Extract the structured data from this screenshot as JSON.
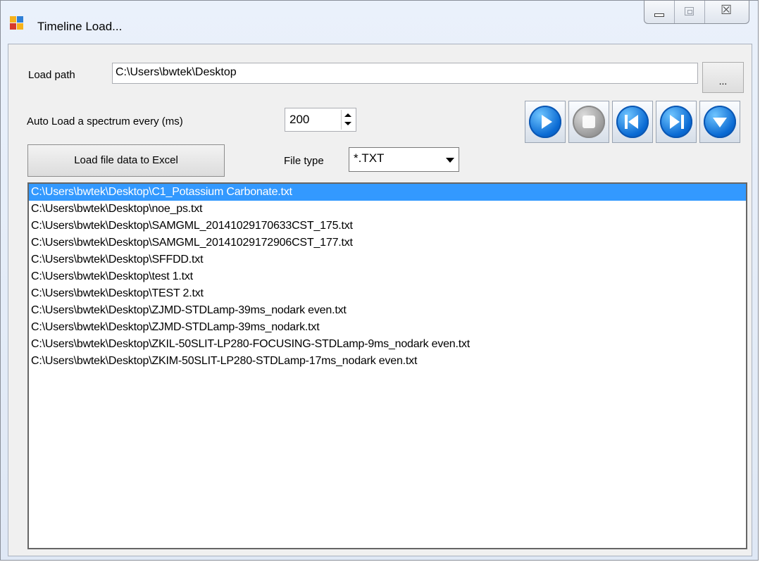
{
  "window": {
    "title": "Timeline Load...",
    "caption_buttons": [
      "minimize",
      "maximize",
      "close"
    ],
    "close_glyph": "☒"
  },
  "form": {
    "load_path_label": "Load path",
    "load_path_value": "C:\\Users\\bwtek\\Desktop",
    "browse_label": "...",
    "auto_load_label": "Auto Load a spectrum every (ms)",
    "auto_load_value": "200",
    "excel_button": "Load file data to Excel",
    "file_type_label": "File type",
    "file_type_value": "*.TXT"
  },
  "media_buttons": [
    "play-icon",
    "stop-icon",
    "previous-icon",
    "next-icon",
    "down-icon"
  ],
  "colors": {
    "selection": "#3399ff",
    "media_blue": "#0a6ad3"
  },
  "files": [
    "C:\\Users\\bwtek\\Desktop\\C1_Potassium Carbonate.txt",
    "C:\\Users\\bwtek\\Desktop\\noe_ps.txt",
    "C:\\Users\\bwtek\\Desktop\\SAMGML_20141029170633CST_175.txt",
    "C:\\Users\\bwtek\\Desktop\\SAMGML_20141029172906CST_177.txt",
    "C:\\Users\\bwtek\\Desktop\\SFFDD.txt",
    "C:\\Users\\bwtek\\Desktop\\test 1.txt",
    "C:\\Users\\bwtek\\Desktop\\TEST 2.txt",
    "C:\\Users\\bwtek\\Desktop\\ZJMD-STDLamp-39ms_nodark even.txt",
    "C:\\Users\\bwtek\\Desktop\\ZJMD-STDLamp-39ms_nodark.txt",
    "C:\\Users\\bwtek\\Desktop\\ZKIL-50SLIT-LP280-FOCUSING-STDLamp-9ms_nodark even.txt",
    "C:\\Users\\bwtek\\Desktop\\ZKIM-50SLIT-LP280-STDLamp-17ms_nodark even.txt"
  ],
  "selected_index": 0
}
